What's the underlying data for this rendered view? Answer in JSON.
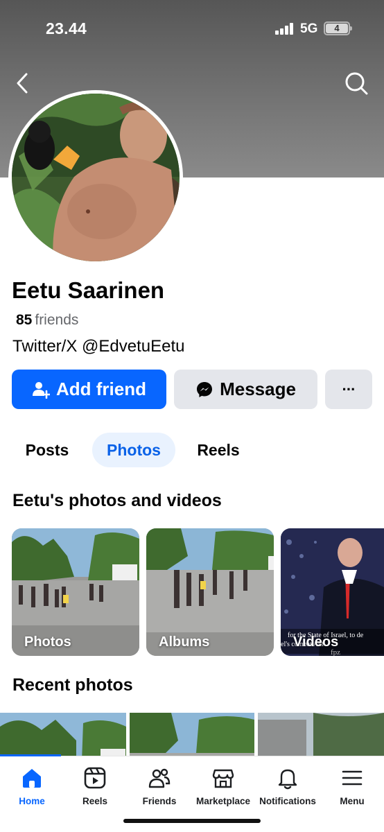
{
  "status_bar": {
    "time": "23.44",
    "network": "5G",
    "battery": "4"
  },
  "profile": {
    "name": "Eetu Saarinen",
    "friends_count": "85",
    "friends_label": "friends",
    "bio": "Twitter/X @EdvetuEetu"
  },
  "actions": {
    "add_friend_label": "Add friend",
    "message_label": "Message",
    "more_label": "···"
  },
  "tabs": [
    {
      "label": "Posts",
      "active": false
    },
    {
      "label": "Photos",
      "active": true
    },
    {
      "label": "Reels",
      "active": false
    }
  ],
  "photos_section": {
    "title": "Eetu's photos and videos",
    "cards": [
      {
        "label": "Photos"
      },
      {
        "label": "Albums"
      },
      {
        "label": "Videos",
        "caption_line1": "for the State of Israel, to de",
        "caption_line2": "el's     combat Ant",
        "watermark": "fpz"
      }
    ]
  },
  "recent_section": {
    "title": "Recent photos"
  },
  "bottom_nav": [
    {
      "label": "Home",
      "icon": "home-icon",
      "active": true
    },
    {
      "label": "Reels",
      "icon": "reels-icon",
      "active": false
    },
    {
      "label": "Friends",
      "icon": "friends-icon",
      "active": false
    },
    {
      "label": "Marketplace",
      "icon": "marketplace-icon",
      "active": false
    },
    {
      "label": "Notifications",
      "icon": "bell-icon",
      "active": false
    },
    {
      "label": "Menu",
      "icon": "menu-icon",
      "active": false
    }
  ],
  "colors": {
    "accent": "#0866ff",
    "tab_active_bg": "#e9f2fe",
    "secondary_button": "#e4e6eb"
  }
}
